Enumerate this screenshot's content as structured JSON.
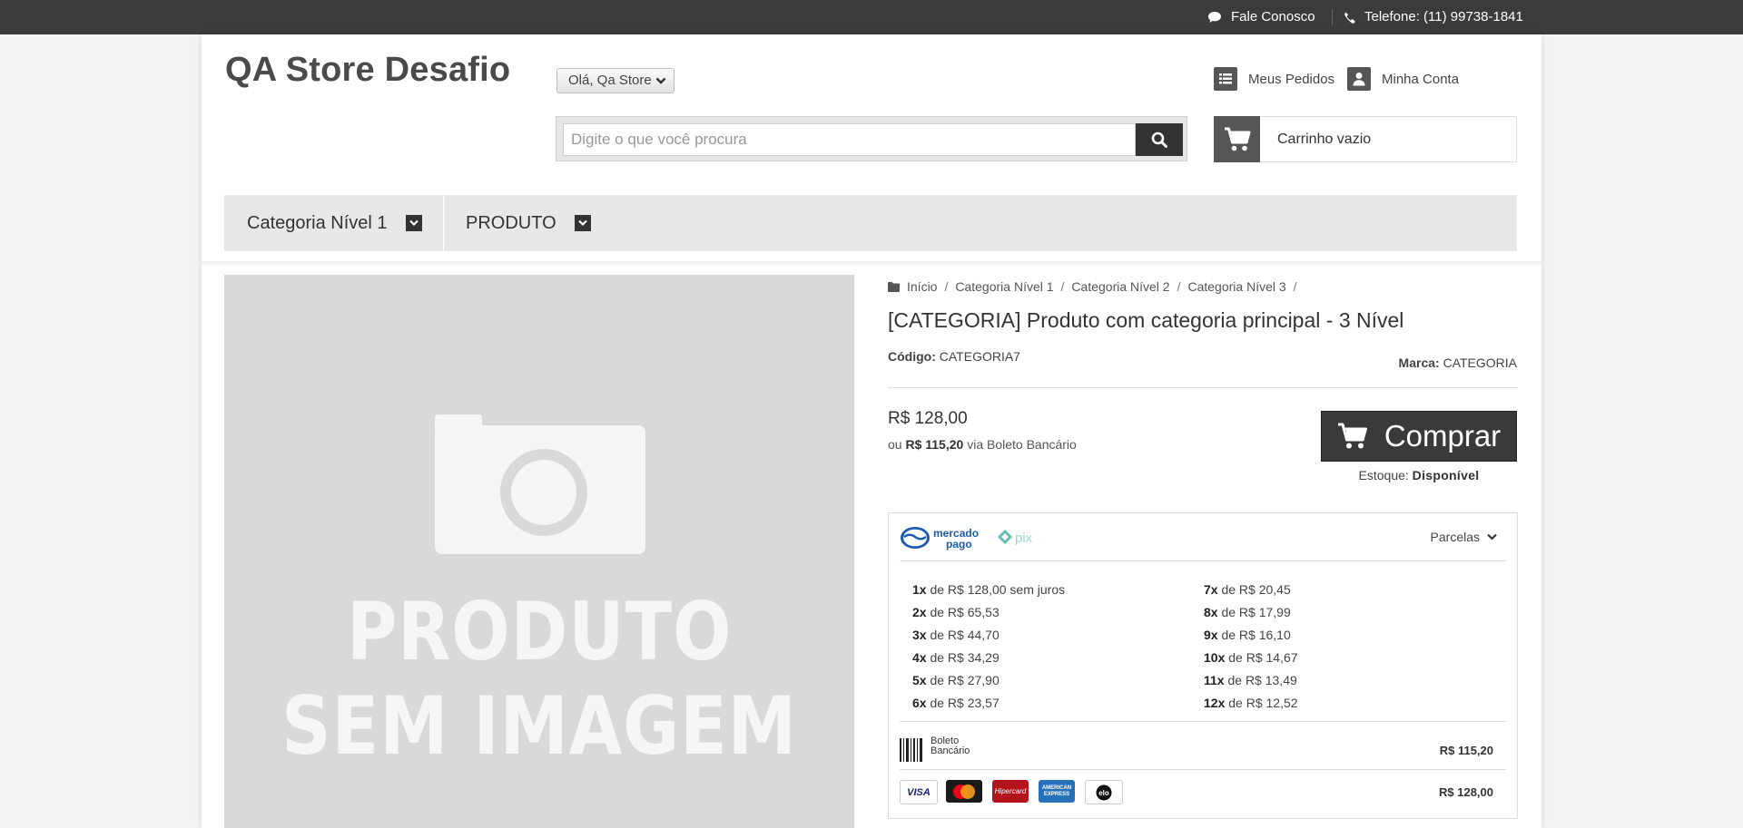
{
  "topbar": {
    "contact_label": "Fale Conosco",
    "phone_label": "Telefone: (11) 99738-1841"
  },
  "header": {
    "store_name": "QA Store Desafio",
    "greeting": "Olá, Qa Store",
    "orders_label": "Meus Pedidos",
    "account_label": "Minha Conta",
    "search_placeholder": "Digite o que você procura",
    "cart_label": "Carrinho vazio"
  },
  "nav": {
    "items": [
      {
        "label": "Categoria Nível 1"
      },
      {
        "label": "PRODUTO"
      }
    ]
  },
  "product_image": {
    "line1": "PRODUTO",
    "line2": "SEM IMAGEM"
  },
  "breadcrumb": [
    "Início",
    "Categoria Nível 1",
    "Categoria Nível 2",
    "Categoria Nível 3"
  ],
  "product": {
    "title": "[CATEGORIA] Produto com categoria principal - 3 Nível",
    "code_label": "Código:",
    "code_value": "CATEGORIA7",
    "brand_label": "Marca:",
    "brand_value": "CATEGORIA",
    "price": "R$ 128,00",
    "boleto_prefix": "ou",
    "boleto_price": "R$ 115,20",
    "boleto_suffix": "via Boleto Bancário",
    "buy_label": "Comprar",
    "stock_label": "Estoque:",
    "stock_value": "Disponível"
  },
  "payment": {
    "mp_text1": "mercado",
    "mp_text2": "pago",
    "pix_text": "pix",
    "parcelas_label": "Parcelas",
    "installments_left": [
      {
        "n": "1x",
        "text": "de R$ 128,00 sem juros"
      },
      {
        "n": "2x",
        "text": "de R$ 65,53"
      },
      {
        "n": "3x",
        "text": "de R$ 44,70"
      },
      {
        "n": "4x",
        "text": "de R$ 34,29"
      },
      {
        "n": "5x",
        "text": "de R$ 27,90"
      },
      {
        "n": "6x",
        "text": "de R$ 23,57"
      }
    ],
    "installments_right": [
      {
        "n": "7x",
        "text": "de R$ 20,45"
      },
      {
        "n": "8x",
        "text": "de R$ 17,99"
      },
      {
        "n": "9x",
        "text": "de R$ 16,10"
      },
      {
        "n": "10x",
        "text": "de R$ 14,67"
      },
      {
        "n": "11x",
        "text": "de R$ 13,49"
      },
      {
        "n": "12x",
        "text": "de R$ 12,52"
      }
    ],
    "boleto_label_1": "Boleto",
    "boleto_label_2": "Bancário",
    "boleto_price": "R$ 115,20",
    "cards": [
      "VISA",
      "Mastercard",
      "Hipercard",
      "AMERICAN EXPRESS",
      "elo"
    ],
    "cards_price": "R$ 128,00"
  },
  "colors": {
    "topbar": "#3b3b3b",
    "buy_button": "#3a3a3a",
    "nav_bg": "#e8e8e8",
    "image_placeholder": "#d9d9d9"
  }
}
